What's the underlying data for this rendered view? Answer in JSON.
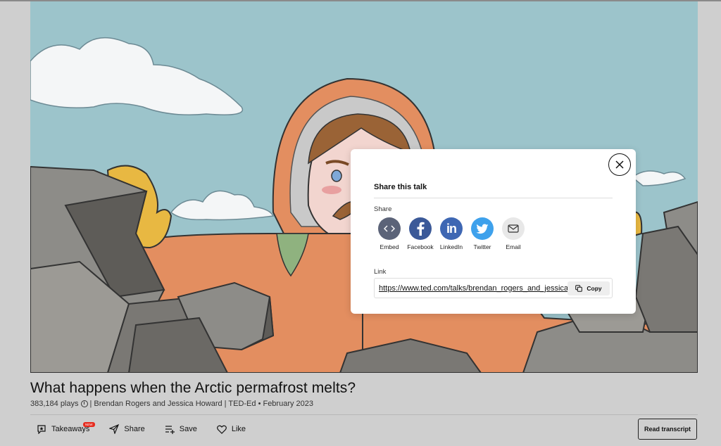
{
  "video": {
    "scene": "Arctic explorer in orange parka among rocks, animated illustration"
  },
  "talk": {
    "title": "What happens when the Arctic permafrost melts?",
    "plays": "383,184 plays",
    "byline": "| Brendan Rogers and Jessica Howard | TED-Ed • February 2023"
  },
  "actions": {
    "takeaways": "Takeaways",
    "new_badge": "NEW",
    "share": "Share",
    "save": "Save",
    "like": "Like",
    "read_transcript": "Read transcript"
  },
  "share_modal": {
    "title": "Share this talk",
    "share_label": "Share",
    "options": [
      {
        "label": "Embed",
        "icon": "embed-icon",
        "color": "#5b6378"
      },
      {
        "label": "Facebook",
        "icon": "facebook-icon",
        "color": "#3b5998"
      },
      {
        "label": "LinkedIn",
        "icon": "linkedin-icon",
        "color": "#3e67b3"
      },
      {
        "label": "Twitter",
        "icon": "twitter-icon",
        "color": "#3ea1ec"
      },
      {
        "label": "Email",
        "icon": "email-icon",
        "color": "#e8e8e8"
      }
    ],
    "link_label": "Link",
    "link_url": "https://www.ted.com/talks/brendan_rogers_and_jessica_howard_what_happens_when_the_arctic_permafrost_melts",
    "copy_label": "Copy"
  }
}
